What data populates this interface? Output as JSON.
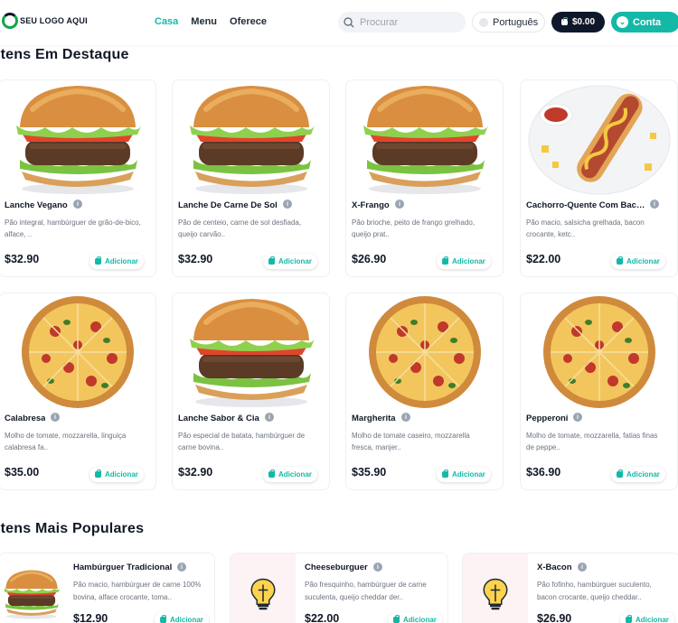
{
  "header": {
    "logo_text": "SEU LOGO AQUI",
    "nav": [
      "Casa",
      "Menu",
      "Oferece"
    ],
    "search_placeholder": "Procurar",
    "language": "Português",
    "cart_total": "$0.00",
    "account_label": "Conta",
    "accent_color": "#14b8a6"
  },
  "featured": {
    "title": "Itens Em Destaque",
    "add_label": "Adicionar",
    "items": [
      {
        "name": "Lanche Vegano",
        "desc": "Pão integral, hambúrguer de grão-de-bico, alface, ..",
        "price": "$32.90",
        "image": "burger"
      },
      {
        "name": "Lanche De Carne De Sol",
        "desc": "Pão de centeio, carne de sol desfiada, queijo carvão..",
        "price": "$32.90",
        "image": "burger"
      },
      {
        "name": "X-Frango",
        "desc": "Pão brioche, peito de frango grelhado, queijo prat..",
        "price": "$26.90",
        "image": "burger"
      },
      {
        "name": "Cachorro-Quente Com Bac…",
        "desc": "Pão macio, salsicha grelhada, bacon crocante, ketc..",
        "price": "$22.00",
        "image": "hotdog"
      },
      {
        "name": "Calabresa",
        "desc": "Molho de tomate, mozzarella, linguiça calabresa fa..",
        "price": "$35.00",
        "image": "pizza"
      },
      {
        "name": "Lanche Sabor & Cia",
        "desc": "Pão especial de batata, hambúrguer de carne bovina..",
        "price": "$32.90",
        "image": "burger"
      },
      {
        "name": "Margherita",
        "desc": "Molho de tomate caseiro, mozzarella fresca, manjer..",
        "price": "$35.90",
        "image": "pizza"
      },
      {
        "name": "Pepperoni",
        "desc": "Molho de tomate, mozzarella, fatias finas de peppe..",
        "price": "$36.90",
        "image": "pizza"
      }
    ]
  },
  "popular": {
    "title": "Itens Mais Populares",
    "add_label": "Adicionar",
    "items": [
      {
        "name": "Hambúrguer Tradicional",
        "desc": "Pão macio, hambúrguer de carne 100% bovina, alface crocante, toma..",
        "price": "$12.90",
        "image": "burger"
      },
      {
        "name": "Cheeseburguer",
        "desc": "Pão fresquinho, hambúrguer de carne suculenta, queijo cheddar der..",
        "price": "$22.00",
        "image": "bulb-icon"
      },
      {
        "name": "X-Bacon",
        "desc": "Pão fofinho, hambúrguer suculento, bacon crocante, queijo cheddar..",
        "price": "$26.90",
        "image": "bulb-icon"
      }
    ]
  }
}
